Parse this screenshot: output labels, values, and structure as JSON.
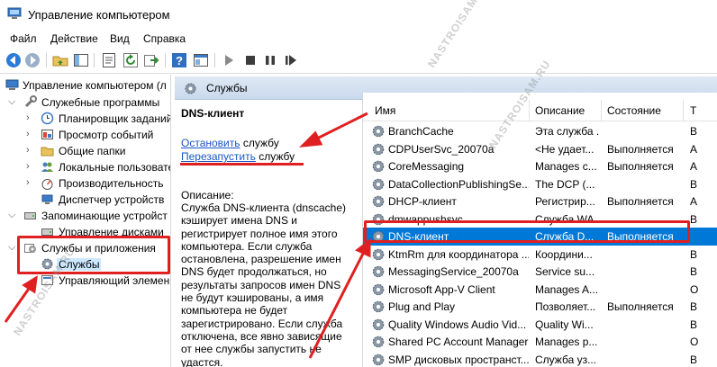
{
  "window": {
    "title": "Управление компьютером"
  },
  "menu": [
    "Файл",
    "Действие",
    "Вид",
    "Справка"
  ],
  "toolbar": {
    "buttons": [
      "back-icon",
      "forward-icon",
      "up-folder-icon",
      "show-hide-tree-icon",
      "properties-icon",
      "refresh-icon",
      "export-icon",
      "help-icon",
      "console-tree-icon",
      "play-icon",
      "stop-icon",
      "pause-icon",
      "restart-icon"
    ]
  },
  "tree": {
    "items": [
      {
        "label": "Управление компьютером (л"
      },
      {
        "label": "Служебные программы"
      },
      {
        "label": "Планировщик заданий"
      },
      {
        "label": "Просмотр событий"
      },
      {
        "label": "Общие папки"
      },
      {
        "label": "Локальные пользовате"
      },
      {
        "label": "Производительность"
      },
      {
        "label": "Диспетчер устройств"
      },
      {
        "label": "Запоминающие устройст"
      },
      {
        "label": "Управление дисками"
      },
      {
        "label": "Службы и приложения"
      },
      {
        "label": "Службы"
      },
      {
        "label": "Управляющий элемен"
      }
    ]
  },
  "pane": {
    "title": "Службы"
  },
  "description": {
    "service_name": "DNS-клиент",
    "stop_link": "Остановить",
    "stop_suffix": " службу",
    "restart_link": "Перезапустить",
    "restart_suffix": " службу",
    "label": "Описание:",
    "text": "Служба DNS-клиента (dnscache) кэширует имена DNS и регистрирует полное имя этого компьютера. Если служба остановлена, разрешение имен DNS будет продолжаться, но результаты запросов имен DNS не будут кэшированы, а имя компьютера не будет зарегистрировано. Если служба отключена, все явно зависящие от нее службы запустить не удастся."
  },
  "list": {
    "columns": [
      "Имя",
      "Описание",
      "Состояние",
      "Т"
    ],
    "rows": [
      {
        "name": "BranchCache",
        "desc": "Эта служба ...",
        "state": "",
        "type": "В"
      },
      {
        "name": "CDPUserSvc_20070a",
        "desc": "<Не удает...",
        "state": "Выполняется",
        "type": "А"
      },
      {
        "name": "CoreMessaging",
        "desc": "Manages c...",
        "state": "Выполняется",
        "type": "А"
      },
      {
        "name": "DataCollectionPublishingSe...",
        "desc": "The DCP (...",
        "state": "",
        "type": "В"
      },
      {
        "name": "DHCP-клиент",
        "desc": "Регистрир...",
        "state": "Выполняется",
        "type": "А"
      },
      {
        "name": "dmwappushsvc",
        "desc": "Служба WA...",
        "state": "",
        "type": "В"
      },
      {
        "name": "DNS-клиент",
        "desc": "Служба D...",
        "state": "Выполняется",
        "type": ""
      },
      {
        "name": "KtmRm для координатора ...",
        "desc": "Координи...",
        "state": "",
        "type": "В"
      },
      {
        "name": "MessagingService_20070a",
        "desc": "Service su...",
        "state": "",
        "type": "В"
      },
      {
        "name": "Microsoft App-V Client",
        "desc": "Manages A...",
        "state": "",
        "type": "О"
      },
      {
        "name": "Plug and Play",
        "desc": "Позволяет...",
        "state": "Выполняется",
        "type": "В"
      },
      {
        "name": "Quality Windows Audio Vid...",
        "desc": "Quality Wi...",
        "state": "",
        "type": "В"
      },
      {
        "name": "Shared PC Account Manager",
        "desc": "Manages p...",
        "state": "",
        "type": "О"
      },
      {
        "name": "SMP дисковых пространст...",
        "desc": "Служба уз...",
        "state": "",
        "type": "В"
      }
    ]
  },
  "watermark": "NASTROISAM.RU",
  "colors": {
    "selection": "#0078d7",
    "annotation": "#e02020",
    "link": "#1a56c4"
  }
}
